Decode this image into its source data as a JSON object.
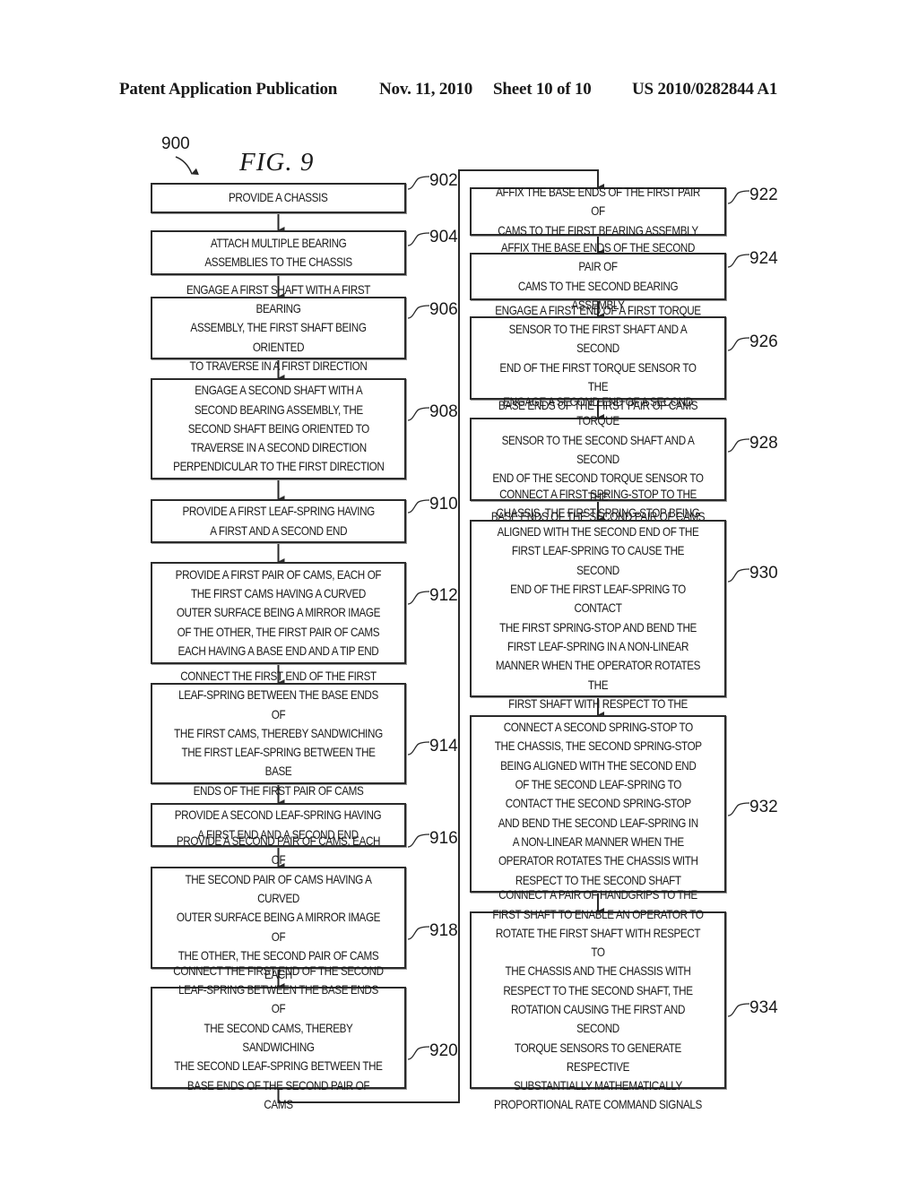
{
  "header": {
    "publication": "Patent Application Publication",
    "date": "Nov. 11, 2010",
    "sheet": "Sheet 10 of 10",
    "number": "US 2010/0282844 A1"
  },
  "figure": {
    "label": "FIG. 9",
    "reference": "900"
  },
  "steps": [
    {
      "ref": "902",
      "text": "PROVIDE A CHASSIS"
    },
    {
      "ref": "904",
      "text": "ATTACH MULTIPLE BEARING\nASSEMBLIES TO THE CHASSIS"
    },
    {
      "ref": "906",
      "text": "ENGAGE A FIRST SHAFT WITH A FIRST BEARING\nASSEMBLY, THE FIRST SHAFT BEING ORIENTED\nTO TRAVERSE IN A FIRST DIRECTION"
    },
    {
      "ref": "908",
      "text": "ENGAGE A SECOND SHAFT WITH A\nSECOND BEARING ASSEMBLY, THE\nSECOND SHAFT BEING ORIENTED TO\nTRAVERSE IN A SECOND DIRECTION\nPERPENDICULAR TO THE FIRST DIRECTION"
    },
    {
      "ref": "910",
      "text": "PROVIDE A FIRST LEAF-SPRING HAVING\nA FIRST AND A SECOND END"
    },
    {
      "ref": "912",
      "text": "PROVIDE A FIRST PAIR OF CAMS, EACH OF\nTHE FIRST CAMS HAVING A CURVED\nOUTER SURFACE BEING A MIRROR IMAGE\nOF THE OTHER, THE FIRST PAIR OF CAMS\nEACH HAVING A BASE END AND A TIP END"
    },
    {
      "ref": "914",
      "text": "CONNECT THE FIRST END OF THE FIRST\nLEAF-SPRING BETWEEN THE BASE ENDS OF\nTHE FIRST CAMS, THEREBY SANDWICHING\nTHE FIRST LEAF-SPRING BETWEEN THE BASE\nENDS OF THE FIRST PAIR OF CAMS"
    },
    {
      "ref": "916",
      "text": "PROVIDE A SECOND LEAF-SPRING HAVING\nA FIRST END AND A SECOND END"
    },
    {
      "ref": "918",
      "text": "PROVIDE A SECOND PAIR OF CAMS, EACH OF\nTHE SECOND PAIR OF CAMS HAVING A CURVED\nOUTER SURFACE BEING A MIRROR IMAGE OF\nTHE OTHER, THE SECOND PAIR OF CAMS EACH\nHAVING A BASE END AND A TIP END"
    },
    {
      "ref": "920",
      "text": "CONNECT THE FIRST END OF THE SECOND\nLEAF-SPRING BETWEEN THE BASE ENDS OF\nTHE SECOND CAMS, THEREBY SANDWICHING\nTHE SECOND LEAF-SPRING BETWEEN THE\nBASE ENDS OF THE SECOND PAIR OF CAMS"
    },
    {
      "ref": "922",
      "text": "AFFIX THE BASE ENDS OF THE FIRST PAIR OF\nCAMS TO THE FIRST BEARING ASSEMBLY"
    },
    {
      "ref": "924",
      "text": "AFFIX THE BASE ENDS OF THE SECOND PAIR OF\nCAMS TO THE SECOND BEARING ASSEMBLY"
    },
    {
      "ref": "926",
      "text": "ENGAGE A FIRST END OF A FIRST TORQUE\nSENSOR TO THE FIRST SHAFT AND A SECOND\nEND OF THE FIRST TORQUE SENSOR TO THE\nBASE ENDS OF THE FIRST PAIR OF CAMS"
    },
    {
      "ref": "928",
      "text": "ENGAGE A SECOND END OF A SECOND TORQUE\nSENSOR TO THE SECOND SHAFT AND A SECOND\nEND OF THE SECOND TORQUE SENSOR TO THE\nBASE ENDS OF THE SECOND PAIR OF CAMS"
    },
    {
      "ref": "930",
      "text": "CONNECT A FIRST SPRING-STOP TO THE\nCHASSIS, THE FIRST SPRING-STOP BEING\nALIGNED WITH THE SECOND END OF THE\nFIRST LEAF-SPRING TO CAUSE THE SECOND\nEND OF THE FIRST LEAF-SPRING TO CONTACT\nTHE FIRST SPRING-STOP AND BEND THE\nFIRST LEAF-SPRING IN A NON-LINEAR\nMANNER WHEN THE OPERATOR ROTATES THE\nFIRST SHAFT WITH RESPECT TO THE CHASSIS"
    },
    {
      "ref": "932",
      "text": "CONNECT A SECOND SPRING-STOP TO\nTHE CHASSIS, THE SECOND SPRING-STOP\nBEING ALIGNED WITH THE SECOND END\nOF THE SECOND LEAF-SPRING TO\nCONTACT THE SECOND SPRING-STOP\nAND BEND THE SECOND LEAF-SPRING IN\nA NON-LINEAR MANNER WHEN THE\nOPERATOR ROTATES THE CHASSIS WITH\nRESPECT TO THE SECOND SHAFT"
    },
    {
      "ref": "934",
      "text": "CONNECT A PAIR OF HANDGRIPS TO THE\nFIRST SHAFT TO ENABLE AN OPERATOR TO\nROTATE THE FIRST SHAFT WITH RESPECT TO\nTHE CHASSIS AND THE CHASSIS WITH\nRESPECT TO THE SECOND SHAFT, THE\nROTATION CAUSING THE FIRST AND SECOND\nTORQUE SENSORS TO GENERATE RESPECTIVE\nSUBSTANTIALLY MATHEMATICALLY\nPROPORTIONAL RATE COMMAND SIGNALS"
    }
  ]
}
